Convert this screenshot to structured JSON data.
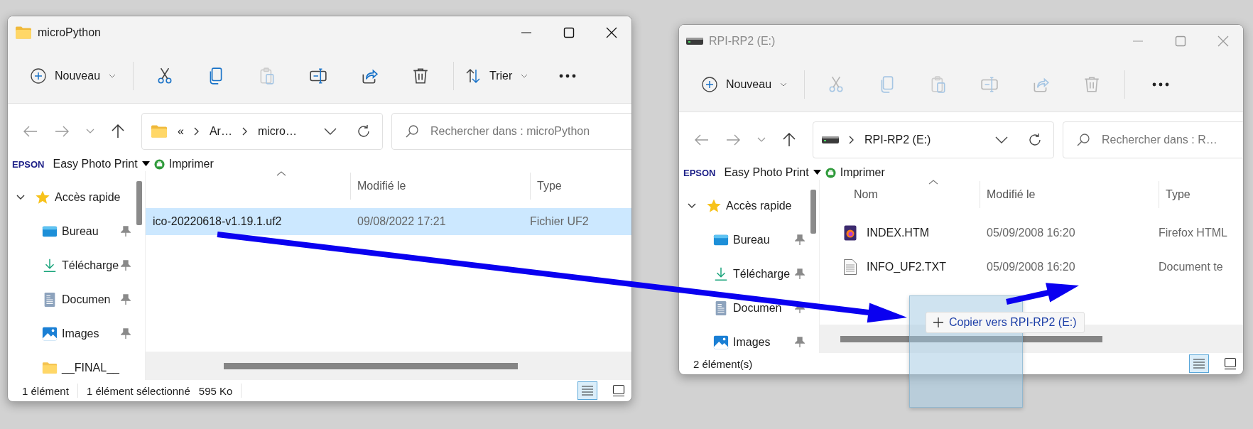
{
  "windows": [
    {
      "kind": "folder",
      "title": "microPython",
      "active": true,
      "toolbar": {
        "new_label": "Nouveau",
        "tools": [
          {
            "kind": "cut",
            "disabled": false
          },
          {
            "kind": "copy",
            "disabled": false
          },
          {
            "kind": "paste",
            "disabled": true
          },
          {
            "kind": "rename",
            "disabled": false
          },
          {
            "kind": "share",
            "disabled": false
          },
          {
            "kind": "delete",
            "disabled": false
          }
        ],
        "sort_label": "Trier"
      },
      "address": {
        "kind": "folder",
        "overflow": "«",
        "parts": [
          "Ar…",
          "micro…"
        ]
      },
      "search": {
        "placeholder": "Rechercher dans : microPython"
      },
      "epson": {
        "brand": "EPSON",
        "app": "Easy Photo Print",
        "print": "Imprimer"
      },
      "nav": [
        {
          "label": "Accès rapide",
          "kind": "quick",
          "expanded": true,
          "pinned": false
        },
        {
          "label": "Bureau",
          "kind": "desktop",
          "pinned": true
        },
        {
          "label": "Télécharge",
          "kind": "download",
          "pinned": true
        },
        {
          "label": "Documen",
          "kind": "document",
          "pinned": true
        },
        {
          "label": "Images",
          "kind": "images",
          "pinned": true
        },
        {
          "label": "__FINAL__",
          "kind": "folder",
          "pinned": false
        }
      ],
      "columns": [
        "Modifié le",
        "Type"
      ],
      "files": [
        {
          "name": "ico-20220618-v1.19.1.uf2",
          "modified": "09/08/2022 17:21",
          "type": "Fichier UF2",
          "selected": true
        }
      ],
      "status": {
        "count": "1 élément",
        "selection": "1 élément sélectionné",
        "size": "595 Ko"
      },
      "view": [
        {
          "kind": "details",
          "selected": true
        },
        {
          "kind": "tiles",
          "selected": false
        }
      ]
    },
    {
      "kind": "drive",
      "title": "RPI-RP2 (E:)",
      "active": false,
      "toolbar": {
        "new_label": "Nouveau",
        "tools": [
          {
            "kind": "cut",
            "disabled": true
          },
          {
            "kind": "copy",
            "disabled": true
          },
          {
            "kind": "paste",
            "disabled": true
          },
          {
            "kind": "rename",
            "disabled": true
          },
          {
            "kind": "share",
            "disabled": true
          },
          {
            "kind": "delete",
            "disabled": true
          }
        ]
      },
      "address": {
        "kind": "drive",
        "parts": [
          "RPI-RP2 (E:)"
        ]
      },
      "search": {
        "placeholder": "Rechercher dans : R…"
      },
      "epson": {
        "brand": "EPSON",
        "app": "Easy Photo Print",
        "print": "Imprimer"
      },
      "nav": [
        {
          "label": "Accès rapide",
          "kind": "quick",
          "expanded": true,
          "pinned": false
        },
        {
          "label": "Bureau",
          "kind": "desktop",
          "pinned": true
        },
        {
          "label": "Télécharge",
          "kind": "download",
          "pinned": true
        },
        {
          "label": "Documen",
          "kind": "document",
          "pinned": true
        },
        {
          "label": "Images",
          "kind": "images",
          "pinned": true
        }
      ],
      "name_column": "Nom",
      "columns": [
        "Modifié le",
        "Type"
      ],
      "files": [
        {
          "name": "INDEX.HTM",
          "modified": "05/09/2008 16:20",
          "type": "Firefox HTML",
          "kind": "html",
          "selected": false
        },
        {
          "name": "INFO_UF2.TXT",
          "modified": "05/09/2008 16:20",
          "type": "Document te",
          "kind": "text",
          "selected": false
        }
      ],
      "status": {
        "count": "2 élément(s)"
      },
      "view": [
        {
          "kind": "details",
          "selected": true
        },
        {
          "kind": "tiles",
          "selected": false
        }
      ]
    }
  ],
  "drag": {
    "tooltip": "Copier vers RPI-RP2 (E:)"
  }
}
